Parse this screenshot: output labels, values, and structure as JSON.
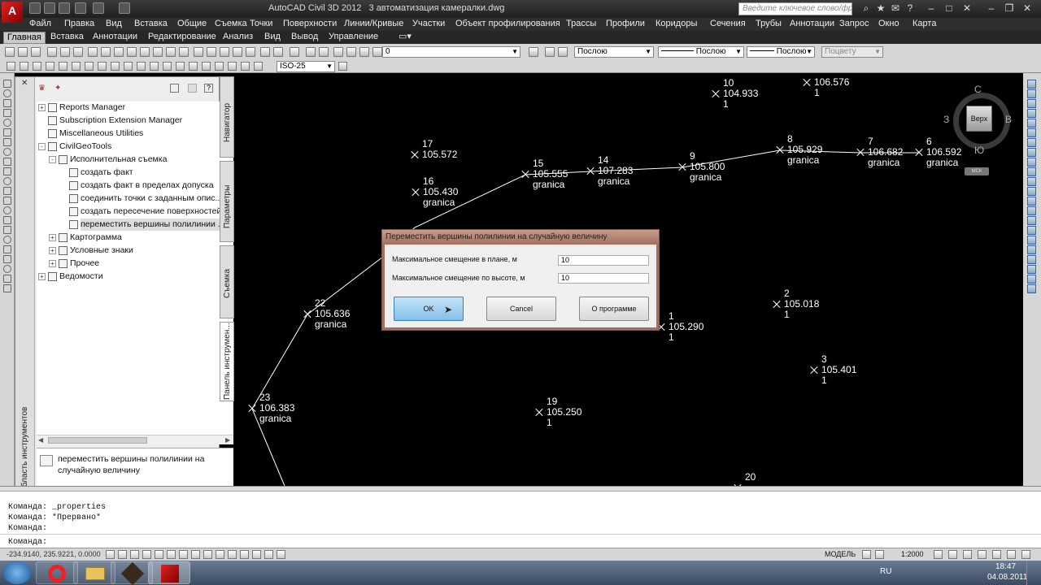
{
  "app": {
    "title": "AutoCAD Civil 3D 2012",
    "document": "3 автоматизация камералки.dwg",
    "logo_letter": "A",
    "search_placeholder": "Введите ключевое слово/фразу"
  },
  "menu": [
    "Файл",
    "Правка",
    "Вид",
    "Вставка",
    "Общие",
    "Съемка",
    "Точки",
    "Поверхности",
    "Линии/Кривые",
    "Участки",
    "Объект профилирования",
    "Трассы",
    "Профили",
    "Коридоры",
    "Сечения",
    "Трубы",
    "Аннотации",
    "Запрос",
    "Окно",
    "Карта"
  ],
  "ribbon_tabs": [
    "Главная",
    "Вставка",
    "Аннотации",
    "Редактирование",
    "Анализ",
    "Вид",
    "Вывод",
    "Управление"
  ],
  "toolbar": {
    "layer_value": "0",
    "color_value": "Послою",
    "linetype_value": "Послою",
    "lineweight_value": "Послою",
    "plotstyle_value": "Поцвету",
    "dimstyle_value": "ISO-25"
  },
  "tool_palette": {
    "title": "Область инструментов",
    "tabs": [
      "Навигатор",
      "Параметры",
      "Съемка",
      "Панель инструмен..."
    ],
    "tree": [
      {
        "label": "Reports Manager",
        "level": 0,
        "expand": "+"
      },
      {
        "label": "Subscription Extension Manager",
        "level": 0,
        "expand": ""
      },
      {
        "label": "Miscellaneous Utilities",
        "level": 0,
        "expand": ""
      },
      {
        "label": "CivilGeoTools",
        "level": 0,
        "expand": "-"
      },
      {
        "label": "Исполнительная съемка",
        "level": 1,
        "expand": "-"
      },
      {
        "label": "создать факт",
        "level": 2,
        "expand": ""
      },
      {
        "label": "создать факт в пределах допуска",
        "level": 2,
        "expand": ""
      },
      {
        "label": "соединить точки с заданным опис...",
        "level": 2,
        "expand": ""
      },
      {
        "label": "создать пересечение поверхностей",
        "level": 2,
        "expand": ""
      },
      {
        "label": "переместить вершины полилинии ...",
        "level": 2,
        "expand": "",
        "selected": true
      },
      {
        "label": "Картограмма",
        "level": 1,
        "expand": "+"
      },
      {
        "label": "Условные знаки",
        "level": 1,
        "expand": "+"
      },
      {
        "label": "Прочее",
        "level": 1,
        "expand": "+"
      },
      {
        "label": "Ведомости",
        "level": 0,
        "expand": "+"
      }
    ],
    "description": "переместить вершины полилинии на случайную величину"
  },
  "points": [
    {
      "num": "10",
      "elev": "104.933",
      "desc": "1"
    },
    {
      "num": "",
      "elev": "106.576",
      "desc": "1"
    },
    {
      "num": "17",
      "elev": "105.572",
      "desc": ""
    },
    {
      "num": "15",
      "elev": "105.555",
      "desc": "granica"
    },
    {
      "num": "14",
      "elev": "107.283",
      "desc": "granica"
    },
    {
      "num": "9",
      "elev": "105.800",
      "desc": "granica"
    },
    {
      "num": "8",
      "elev": "105.929",
      "desc": "granica"
    },
    {
      "num": "7",
      "elev": "106.682",
      "desc": "granica"
    },
    {
      "num": "6",
      "elev": "106.592",
      "desc": "granica"
    },
    {
      "num": "16",
      "elev": "105.430",
      "desc": "granica"
    },
    {
      "num": "22",
      "elev": "105.636",
      "desc": "granica"
    },
    {
      "num": "1",
      "elev": "105.290",
      "desc": "1"
    },
    {
      "num": "2",
      "elev": "105.018",
      "desc": "1"
    },
    {
      "num": "3",
      "elev": "105.401",
      "desc": "1"
    },
    {
      "num": "23",
      "elev": "106.383",
      "desc": "granica"
    },
    {
      "num": "19",
      "elev": "105.250",
      "desc": "1"
    },
    {
      "num": "20",
      "elev": "",
      "desc": ""
    }
  ],
  "viewcube": {
    "north": "С",
    "south": "Ю",
    "west": "З",
    "east": "В",
    "face": "Верх",
    "ucs": "МСК"
  },
  "dialog": {
    "title": "Переместить вершины полилинии на случайную величину",
    "field1_label": "Максимальное смещение в плане, м",
    "field1_value": "10",
    "field2_label": "Максимальное смещение по высоте, м",
    "field2_value": "10",
    "ok": "OK",
    "cancel": "Cancel",
    "about": "О программе"
  },
  "command_line": [
    "Команда: _properties",
    "Команда: *Прервано*",
    "Команда:",
    "Команда:"
  ],
  "status": {
    "coords": "-234.9140, 235.9221, 0.0000",
    "model": "МОДЕЛЬ",
    "scale": "1:2000"
  },
  "taskbar": {
    "lang": "RU",
    "time": "18:47",
    "date": "04.08.2011"
  }
}
